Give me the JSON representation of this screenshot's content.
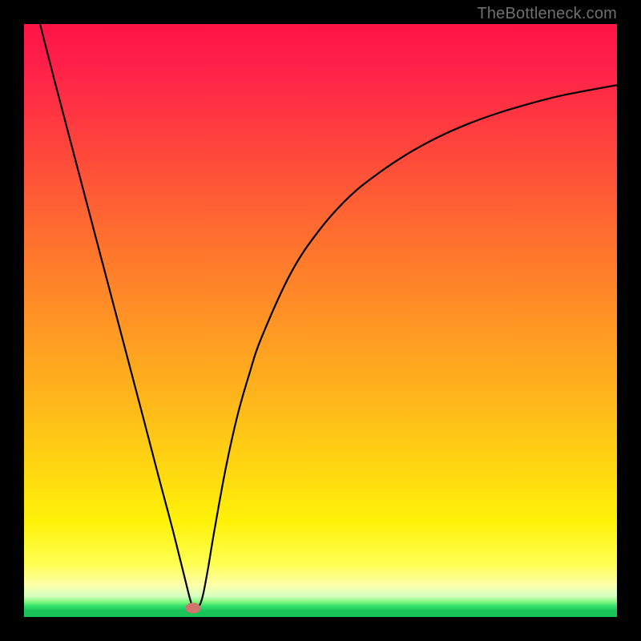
{
  "watermark": {
    "text": "TheBottleneck.com"
  },
  "chart_data": {
    "type": "line",
    "title": "",
    "xlabel": "",
    "ylabel": "",
    "xlim": [
      0,
      100
    ],
    "ylim": [
      0,
      100
    ],
    "grid": false,
    "legend": null,
    "background_gradient": {
      "stops": [
        {
          "pos": 0.0,
          "color": "#ff1547"
        },
        {
          "pos": 0.06,
          "color": "#ff1e4a"
        },
        {
          "pos": 0.18,
          "color": "#ff3d3f"
        },
        {
          "pos": 0.34,
          "color": "#ff6a30"
        },
        {
          "pos": 0.48,
          "color": "#ff8f26"
        },
        {
          "pos": 0.62,
          "color": "#ffb31c"
        },
        {
          "pos": 0.74,
          "color": "#ffd412"
        },
        {
          "pos": 0.84,
          "color": "#fff208"
        },
        {
          "pos": 0.91,
          "color": "#ffff52"
        },
        {
          "pos": 0.945,
          "color": "#ffffa8"
        },
        {
          "pos": 0.965,
          "color": "#d4ffc0"
        },
        {
          "pos": 0.975,
          "color": "#7cf77c"
        },
        {
          "pos": 0.982,
          "color": "#2fe06a"
        },
        {
          "pos": 0.99,
          "color": "#18c45a"
        },
        {
          "pos": 1.0,
          "color": "#18c45a"
        }
      ]
    },
    "series": [
      {
        "name": "bottleneck-curve",
        "color": "#000000",
        "x": [
          2.7,
          5,
          10,
          15,
          20,
          23,
          25,
          27,
          28,
          28.5,
          29,
          30,
          31,
          32,
          34,
          36,
          38,
          40,
          45,
          50,
          55,
          60,
          65,
          70,
          75,
          80,
          85,
          90,
          95,
          100
        ],
        "y": [
          100,
          91,
          72,
          53,
          34,
          22.5,
          15,
          7,
          3,
          1.5,
          1.2,
          3,
          8,
          14,
          25,
          34,
          41,
          47,
          58,
          65.5,
          71,
          75,
          78.3,
          81,
          83.2,
          85,
          86.5,
          87.8,
          88.8,
          89.7
        ]
      }
    ],
    "marker": {
      "name": "optimal-point",
      "x": 28.5,
      "y": 1.5,
      "color": "#d0756e",
      "rx": 1.3,
      "ry": 0.9
    }
  }
}
